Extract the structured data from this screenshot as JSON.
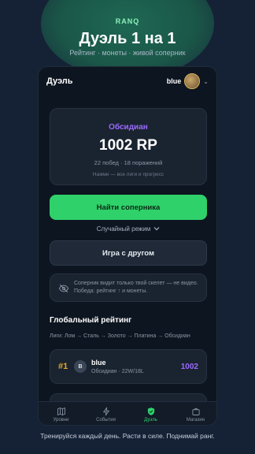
{
  "hero": {
    "brand": "RANQ",
    "title": "Дуэль 1 на 1",
    "subtitle": "Рейтинг · монеты · живой соперник"
  },
  "topbar": {
    "title": "Дуэль",
    "username": "blue"
  },
  "rank_card": {
    "rank_name": "Обсидиан",
    "points": "1002 RP",
    "stats": "22 побед · 18 поражений",
    "hint": "Нажми — все лиги и прогресс"
  },
  "actions": {
    "find_opponent": "Найти соперника",
    "mode": "Случайный режим",
    "play_with_friend": "Игра с другом"
  },
  "info": {
    "text": "Соперник видит только твой скелет — не видео. Победа: рейтинг ↑ и монеты."
  },
  "leaderboard": {
    "title": "Глобальный рейтинг",
    "leagues": "Лиги: Лом → Сталь → Золото → Платина → Обсидиан",
    "rows": [
      {
        "rank": "#1",
        "initial": "B",
        "name": "blue",
        "meta": "Обсидиан · 22W/18L",
        "points": "1002"
      }
    ]
  },
  "tabs": [
    {
      "label": "Уровни",
      "icon": "map-icon"
    },
    {
      "label": "События",
      "icon": "lightning-icon"
    },
    {
      "label": "Дуэль",
      "icon": "shield-icon"
    },
    {
      "label": "Магазин",
      "icon": "bag-icon"
    }
  ],
  "active_tab": "Дуэль",
  "footer": "Тренируйся каждый день. Расти в силе. Поднимай ранг.",
  "colors": {
    "accent": "#2fd16a",
    "rank": "#9b6bff",
    "gold": "#e0a92a",
    "background": "#152236"
  }
}
